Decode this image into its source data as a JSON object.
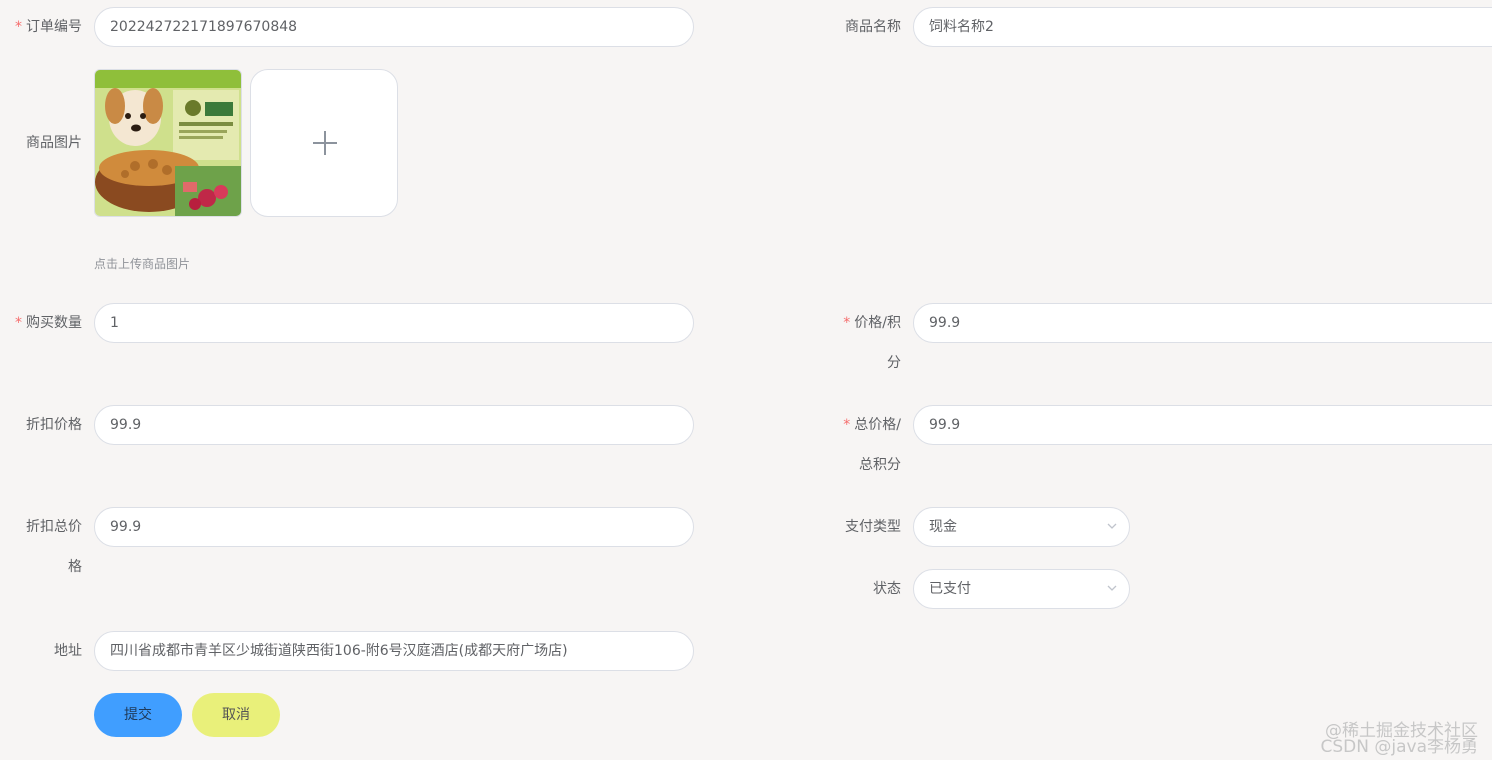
{
  "form": {
    "order_no": {
      "label": "订单编号",
      "value": "202242722171897670848"
    },
    "product_name": {
      "label": "商品名称",
      "value": "饲料名称2"
    },
    "product_image": {
      "label": "商品图片",
      "tip": "点击上传商品图片"
    },
    "quantity": {
      "label": "购买数量",
      "value": "1"
    },
    "price": {
      "label_line1": "价格/积",
      "label_line2": "分",
      "value": "99.9"
    },
    "discount_price": {
      "label": "折扣价格",
      "value": "99.9"
    },
    "total_price": {
      "label_line1": "总价格/",
      "label_line2": "总积分",
      "value": "99.9"
    },
    "discount_total": {
      "label_line1": "折扣总价",
      "label_line2": "格",
      "value": "99.9"
    },
    "pay_type": {
      "label": "支付类型",
      "value": "现金"
    },
    "status": {
      "label": "状态",
      "value": "已支付"
    },
    "address": {
      "label": "地址",
      "value": "四川省成都市青羊区少城街道陕西街106-附6号汉庭酒店(成都天府广场店)"
    }
  },
  "buttons": {
    "submit": "提交",
    "cancel": "取消"
  },
  "watermark": {
    "line1": "@稀土掘金技术社区",
    "line2": "CSDN @java李杨勇"
  },
  "colors": {
    "submit_bg": "#409eff",
    "cancel_bg": "#e9f07a",
    "required": "#f56c6c"
  },
  "required_mark": "*"
}
